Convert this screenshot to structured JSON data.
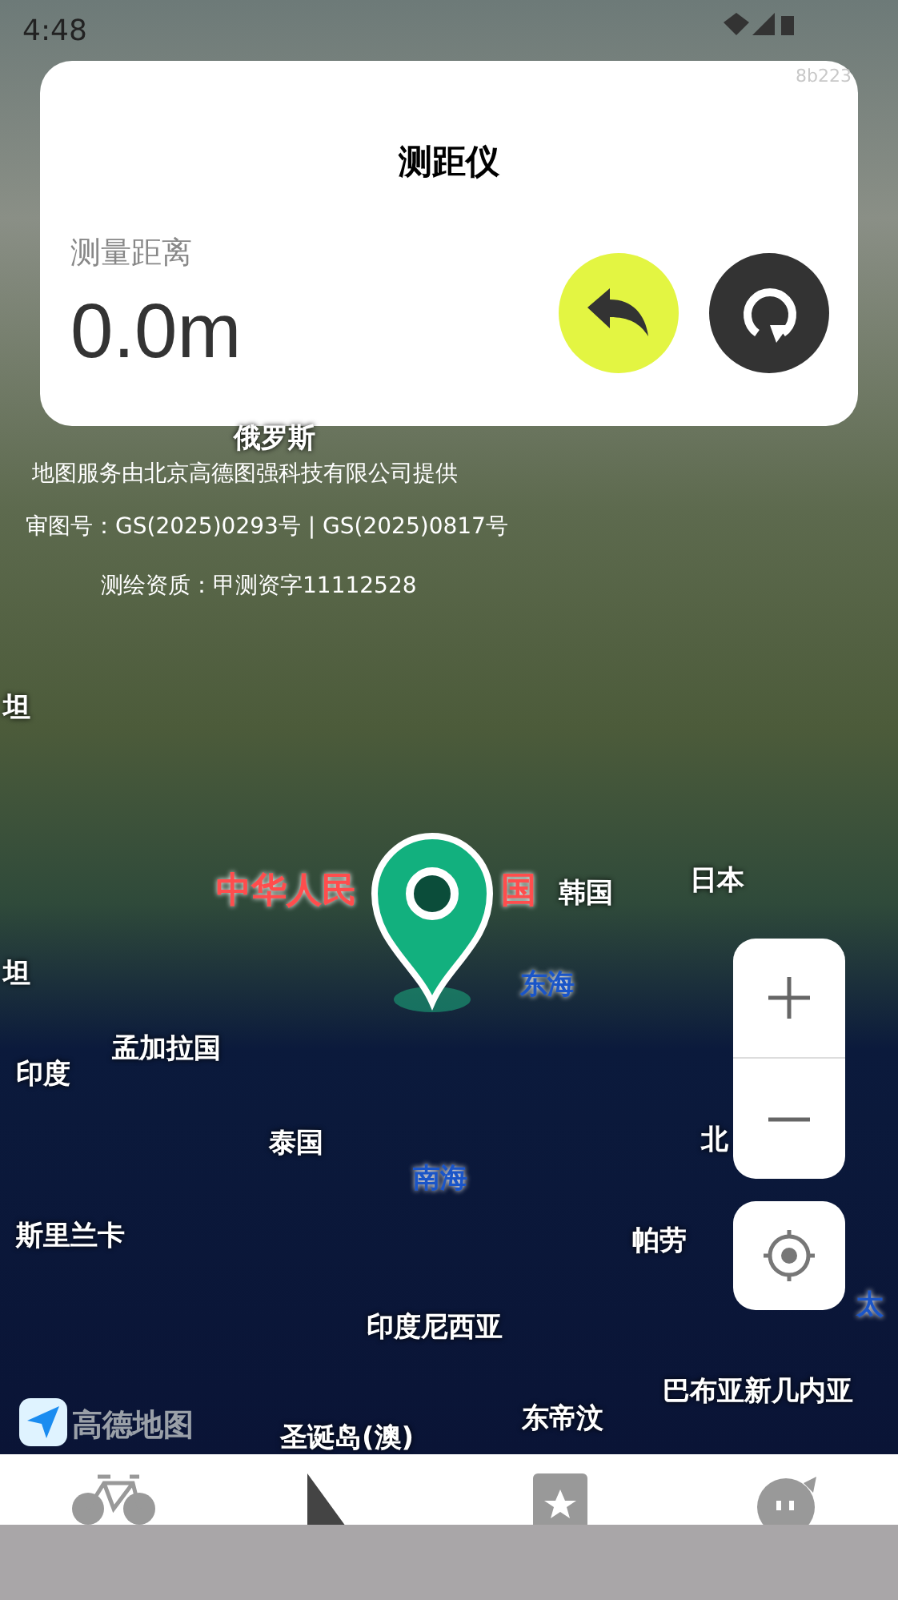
{
  "status_bar": {
    "time": "4:48",
    "build": "8b223"
  },
  "card": {
    "title": "测距仪",
    "label": "测量距离",
    "distance": "0.0m"
  },
  "map": {
    "credits": [
      "地图服务由北京高德图强科技有限公司提供",
      "审图号：GS(2025)0293号 | GS(2025)0817号",
      "测绘资质：甲测资字11112528"
    ],
    "labels": [
      {
        "text": "俄罗斯",
        "kind": "country"
      },
      {
        "text": "坦",
        "kind": "country"
      },
      {
        "text": "中华人民",
        "kind": "home"
      },
      {
        "text": "国",
        "kind": "home"
      },
      {
        "text": "韩国",
        "kind": "country"
      },
      {
        "text": "日本",
        "kind": "country"
      },
      {
        "text": "坦",
        "kind": "country"
      },
      {
        "text": "东海",
        "kind": "sea"
      },
      {
        "text": "孟加拉国",
        "kind": "country"
      },
      {
        "text": "印度",
        "kind": "country"
      },
      {
        "text": "泰国",
        "kind": "country"
      },
      {
        "text": "南海",
        "kind": "sea"
      },
      {
        "text": "北",
        "kind": "country"
      },
      {
        "text": "斯里兰卡",
        "kind": "country"
      },
      {
        "text": "帕劳",
        "kind": "country"
      },
      {
        "text": "太",
        "kind": "sea"
      },
      {
        "text": "印度尼西亚",
        "kind": "country"
      },
      {
        "text": "巴布亚新几内亚",
        "kind": "country"
      },
      {
        "text": "东帝汶",
        "kind": "country"
      },
      {
        "text": "圣诞岛(澳)",
        "kind": "country"
      }
    ],
    "logo": "高德地图"
  }
}
